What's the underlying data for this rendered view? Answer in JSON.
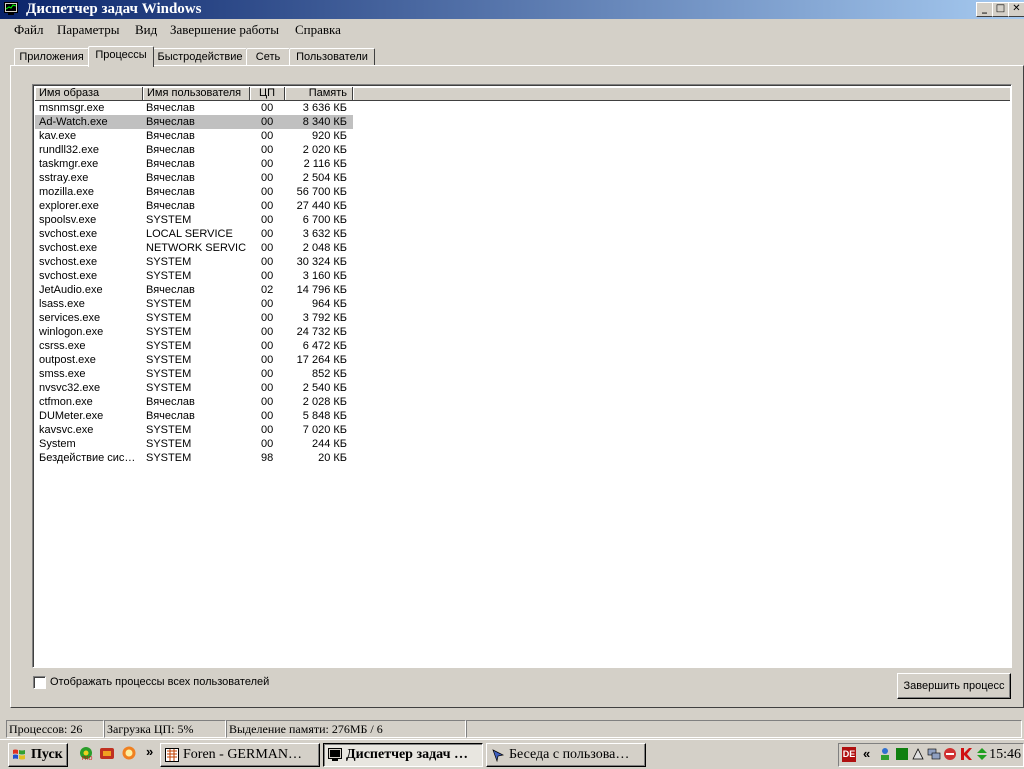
{
  "window": {
    "title": "Диспетчер задач Windows",
    "buttons": {
      "minimize": "_",
      "maximize": "□",
      "close": "✕"
    }
  },
  "menu": [
    "Файл",
    "Параметры",
    "Вид",
    "Завершение работы",
    "Справка"
  ],
  "tabs": [
    "Приложения",
    "Процессы",
    "Быстродействие",
    "Сеть",
    "Пользователи"
  ],
  "active_tab": "Процессы",
  "columns": [
    "Имя образа",
    "Имя пользователя",
    "ЦП",
    "Память"
  ],
  "processes": [
    {
      "name": "msnmsgr.exe",
      "user": "Вячеслав",
      "cpu": "00",
      "mem": "3 636 КБ"
    },
    {
      "name": "Ad-Watch.exe",
      "user": "Вячеслав",
      "cpu": "00",
      "mem": "8 340 КБ",
      "selected": true
    },
    {
      "name": "kav.exe",
      "user": "Вячеслав",
      "cpu": "00",
      "mem": "920 КБ"
    },
    {
      "name": "rundll32.exe",
      "user": "Вячеслав",
      "cpu": "00",
      "mem": "2 020 КБ"
    },
    {
      "name": "taskmgr.exe",
      "user": "Вячеслав",
      "cpu": "00",
      "mem": "2 116 КБ"
    },
    {
      "name": "sstray.exe",
      "user": "Вячеслав",
      "cpu": "00",
      "mem": "2 504 КБ"
    },
    {
      "name": "mozilla.exe",
      "user": "Вячеслав",
      "cpu": "00",
      "mem": "56 700 КБ"
    },
    {
      "name": "explorer.exe",
      "user": "Вячеслав",
      "cpu": "00",
      "mem": "27 440 КБ"
    },
    {
      "name": "spoolsv.exe",
      "user": "SYSTEM",
      "cpu": "00",
      "mem": "6 700 КБ"
    },
    {
      "name": "svchost.exe",
      "user": "LOCAL SERVICE",
      "cpu": "00",
      "mem": "3 632 КБ"
    },
    {
      "name": "svchost.exe",
      "user": "NETWORK SERVICE",
      "cpu": "00",
      "mem": "2 048 КБ"
    },
    {
      "name": "svchost.exe",
      "user": "SYSTEM",
      "cpu": "00",
      "mem": "30 324 КБ"
    },
    {
      "name": "svchost.exe",
      "user": "SYSTEM",
      "cpu": "00",
      "mem": "3 160 КБ"
    },
    {
      "name": "JetAudio.exe",
      "user": "Вячеслав",
      "cpu": "02",
      "mem": "14 796 КБ"
    },
    {
      "name": "lsass.exe",
      "user": "SYSTEM",
      "cpu": "00",
      "mem": "964 КБ"
    },
    {
      "name": "services.exe",
      "user": "SYSTEM",
      "cpu": "00",
      "mem": "3 792 КБ"
    },
    {
      "name": "winlogon.exe",
      "user": "SYSTEM",
      "cpu": "00",
      "mem": "24 732 КБ"
    },
    {
      "name": "csrss.exe",
      "user": "SYSTEM",
      "cpu": "00",
      "mem": "6 472 КБ"
    },
    {
      "name": "outpost.exe",
      "user": "SYSTEM",
      "cpu": "00",
      "mem": "17 264 КБ"
    },
    {
      "name": "smss.exe",
      "user": "SYSTEM",
      "cpu": "00",
      "mem": "852 КБ"
    },
    {
      "name": "nvsvc32.exe",
      "user": "SYSTEM",
      "cpu": "00",
      "mem": "2 540 КБ"
    },
    {
      "name": "ctfmon.exe",
      "user": "Вячеслав",
      "cpu": "00",
      "mem": "2 028 КБ"
    },
    {
      "name": "DUMeter.exe",
      "user": "Вячеслав",
      "cpu": "00",
      "mem": "5 848 КБ"
    },
    {
      "name": "kavsvc.exe",
      "user": "SYSTEM",
      "cpu": "00",
      "mem": "7 020 КБ"
    },
    {
      "name": "System",
      "user": "SYSTEM",
      "cpu": "00",
      "mem": "244 КБ"
    },
    {
      "name": "Бездействие сис…",
      "user": "SYSTEM",
      "cpu": "98",
      "mem": "20 КБ"
    }
  ],
  "show_all_users": {
    "label": "Отображать процессы всех пользователей",
    "checked": false
  },
  "end_process_button": "Завершить процесс",
  "status": {
    "processes": "Процессов: 26",
    "cpu": "Загрузка ЦП: 5%",
    "memory": "Выделение памяти: 276МБ / 6"
  },
  "taskbar": {
    "start": "Пуск",
    "quick_launch": [
      "icq-icon",
      "game-icon",
      "firefox-icon"
    ],
    "overflow": "»",
    "tasks": [
      {
        "label": "Foren - GERMAN…",
        "icon": "forum-icon",
        "active": false
      },
      {
        "label": "Диспетчер задач …",
        "icon": "taskmgr-icon",
        "active": true
      },
      {
        "label": "Беседа с пользова…",
        "icon": "chat-icon",
        "active": false
      }
    ],
    "tray": {
      "language": "DE",
      "overflow": "«",
      "icons": [
        "network-user-icon",
        "dumeter-icon",
        "security-icon",
        "network-icon",
        "adwatch-icon",
        "kav-icon",
        "transfer-icon"
      ],
      "clock": "15:46"
    }
  }
}
